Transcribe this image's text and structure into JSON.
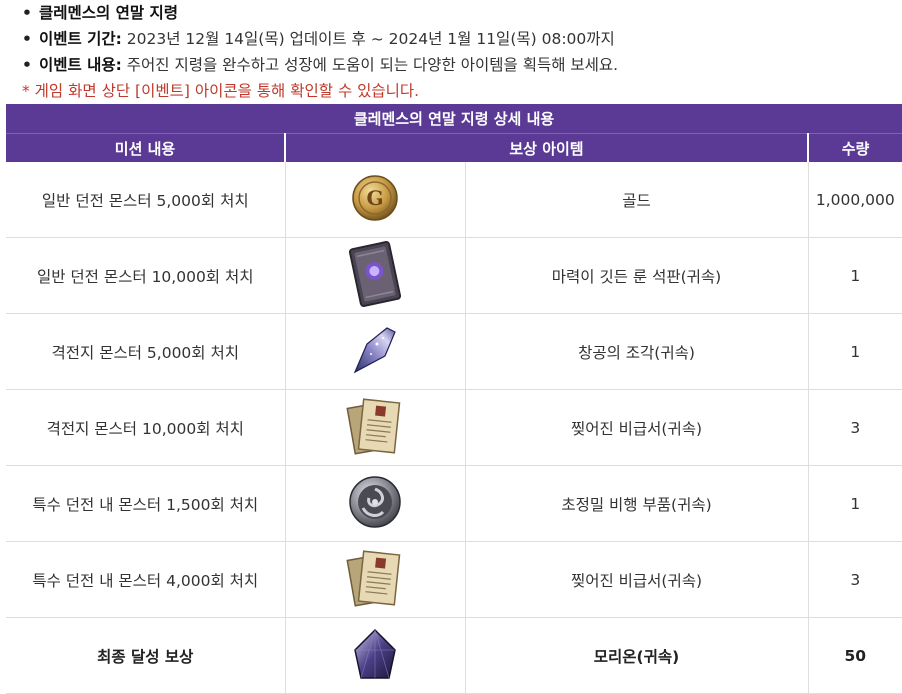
{
  "info": {
    "title": "클레멘스의 연말 지령",
    "period_label": "이벤트 기간:",
    "period_value": " 2023년 12월 14일(목) 업데이트 후 ~ 2024년 1월 11일(목) 08:00까지",
    "content_label": "이벤트 내용:",
    "content_value": " 주어진 지령을 완수하고 성장에 도움이 되는 다양한 아이템을 획득해 보세요.",
    "notice": "* 게임 화면 상단 [이벤트] 아이콘을 통해 확인할 수 있습니다."
  },
  "table": {
    "title": "클레멘스의 연말 지령 상세 내용",
    "headers": {
      "mission": "미션 내용",
      "reward": "보상 아이템",
      "quantity": "수량"
    },
    "rows": [
      {
        "mission": "일반 던전 몬스터 5,000회 처치",
        "icon": "gold-coin-icon",
        "item": "골드",
        "qty": "1,000,000"
      },
      {
        "mission": "일반 던전 몬스터 10,000회 처치",
        "icon": "rune-tablet-icon",
        "item": "마력이 깃든 룬 석판(귀속)",
        "qty": "1"
      },
      {
        "mission": "격전지 몬스터 5,000회 처치",
        "icon": "creation-shard-icon",
        "item": "창공의 조각(귀속)",
        "qty": "1"
      },
      {
        "mission": "격전지 몬스터 10,000회 처치",
        "icon": "torn-scroll-icon",
        "item": "찢어진 비급서(귀속)",
        "qty": "3"
      },
      {
        "mission": "특수 던전 내 몬스터 1,500회 처치",
        "icon": "precision-part-icon",
        "item": "초정밀 비행 부품(귀속)",
        "qty": "1"
      },
      {
        "mission": "특수 던전 내 몬스터 4,000회 처치",
        "icon": "torn-scroll-icon",
        "item": "찢어진 비급서(귀속)",
        "qty": "3"
      },
      {
        "mission": "최종 달성 보상",
        "icon": "morion-crystal-icon",
        "item": "모리온(귀속)",
        "qty": "50"
      }
    ]
  },
  "colors": {
    "header_bg": "#5b3a95",
    "notice": "#c0392b",
    "border": "#dedede"
  }
}
